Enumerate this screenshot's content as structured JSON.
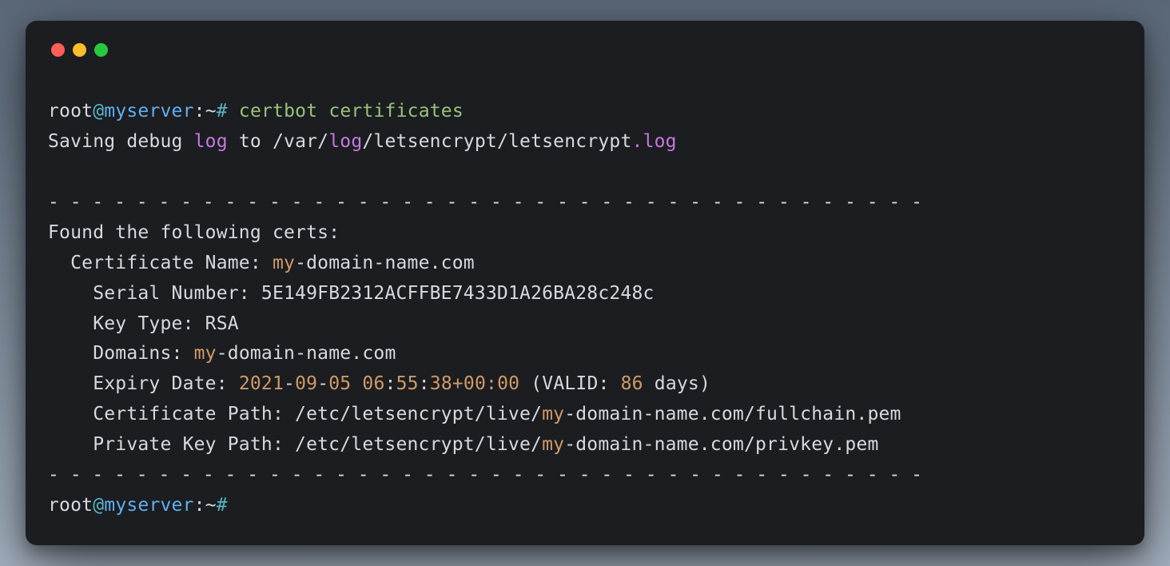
{
  "prompt": {
    "user": "root",
    "at": "@",
    "host": "myserver",
    "sep": ":",
    "path": "~",
    "hash": "#"
  },
  "command": {
    "cmd": "certbot",
    "arg": "certificates"
  },
  "out": {
    "saving1": "Saving debug ",
    "log1": "log",
    "saving2": " to /var/",
    "log2": "log",
    "saving3": "/letsencrypt/letsencrypt",
    "dotlog": ".log",
    "blank": "",
    "dashline": "- - - - - - - - - - - - - - - - - - - - - - - - - - - - - - - - - - - - - - - -",
    "found": "Found the following certs:",
    "certname_lbl": "  Certificate Name: ",
    "certname_val1": "my",
    "certname_val2": "-domain-name.com",
    "serial_lbl": "    Serial Number: ",
    "serial_val": "5E149FB2312ACFFBE7433D1A26BA28c248c",
    "keytype_lbl": "    Key Type: ",
    "keytype_val": "RSA",
    "domains_lbl": "    Domains: ",
    "domains_val1": "my",
    "domains_val2": "-domain-name.com",
    "expiry_lbl": "    Expiry Date: ",
    "expiry_y": "2021",
    "expiry_d1": "-",
    "expiry_m": "09",
    "expiry_d2": "-",
    "expiry_dd": "05",
    "expiry_sp": " ",
    "expiry_h": "06",
    "expiry_c1": ":",
    "expiry_mm": "55",
    "expiry_c2": ":",
    "expiry_ss": "38",
    "expiry_tz": "+00:00",
    "expiry_valid1": " (VALID: ",
    "expiry_days": "86",
    "expiry_valid2": " days)",
    "certpath_lbl": "    Certificate Path: /etc/letsencrypt/live/",
    "certpath_my": "my",
    "certpath_rest": "-domain-name.com/fullchain.pem",
    "keypath_lbl": "    Private Key Path: /etc/letsencrypt/live/",
    "keypath_my": "my",
    "keypath_rest": "-domain-name.com/privkey.pem"
  }
}
